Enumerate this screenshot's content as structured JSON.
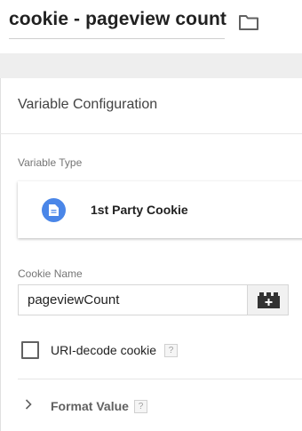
{
  "header": {
    "variable_name": "cookie - pageview count",
    "folder_icon": "folder-outline-icon"
  },
  "config": {
    "section_title": "Variable Configuration",
    "variable_type_label": "Variable Type",
    "variable_type_name": "1st Party Cookie",
    "variable_type_icon": "document-icon",
    "variable_type_icon_color": "#4a86e8",
    "cookie_name_label": "Cookie Name",
    "cookie_name_value": "pageviewCount",
    "variable_picker_icon": "lego-brick-plus-icon",
    "uri_decode_label": "URI-decode cookie",
    "uri_decode_checked": false,
    "help_text": "?",
    "format_value_label": "Format Value",
    "format_value_expanded": false
  }
}
